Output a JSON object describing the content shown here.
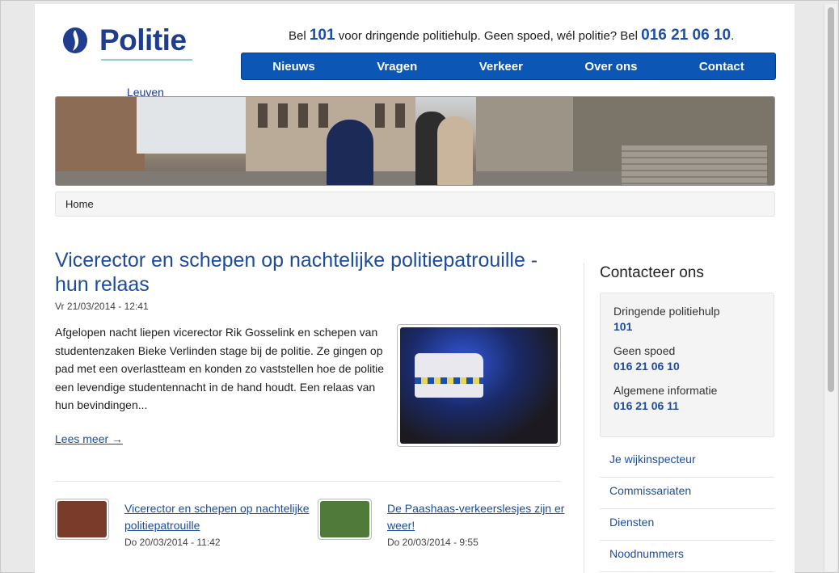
{
  "header": {
    "logo_text": "Politie",
    "logo_city": "Leuven",
    "topline": {
      "prefix": "Bel ",
      "emergency_number": "101",
      "middle": " voor dringende politiehulp. Geen spoed, wél politie? Bel ",
      "general_number": "016 21 06 10",
      "suffix": "."
    }
  },
  "nav": {
    "items": [
      "Nieuws",
      "Vragen",
      "Verkeer",
      "Over ons",
      "Contact"
    ]
  },
  "breadcrumb": {
    "home": "Home"
  },
  "article": {
    "title": "Vicerector en schepen op nachtelijke politiepatrouille - hun relaas",
    "date": "Vr 21/03/2014 - 12:41",
    "body": "Afgelopen nacht liepen vicerector Rik Gosselink en schepen van studentenzaken Bieke Verlinden stage bij de politie. Ze gingen op pad met een overlastteam en konden zo vaststellen hoe de politie een levendige studentennacht in de hand houdt. Een relaas van hun bevindingen...",
    "read_more": "Lees meer →"
  },
  "teasers": [
    {
      "title": "Vicerector en schepen op nachtelijke politiepatrouille",
      "date": "Do 20/03/2014 - 11:42",
      "thumb_color": "#7a3b2a"
    },
    {
      "title": "De Paashaas-verkeerslesjes zijn er weer!",
      "date": "Do 20/03/2014 - 9:55",
      "thumb_color": "#4f7a3a"
    }
  ],
  "sidebar": {
    "title": "Contacteer ons",
    "contacts": [
      {
        "label": "Dringende politiehulp",
        "value": "101"
      },
      {
        "label": "Geen spoed",
        "value": "016 21 06 10"
      },
      {
        "label": "Algemene informatie",
        "value": "016 21 06 11"
      }
    ],
    "links": [
      "Je wijkinspecteur",
      "Commissariaten",
      "Diensten",
      "Noodnummers"
    ]
  },
  "colors": {
    "brand_blue": "#1e3d8f",
    "nav_blue": "#0c56b5",
    "link_blue": "#1d4c9a"
  }
}
